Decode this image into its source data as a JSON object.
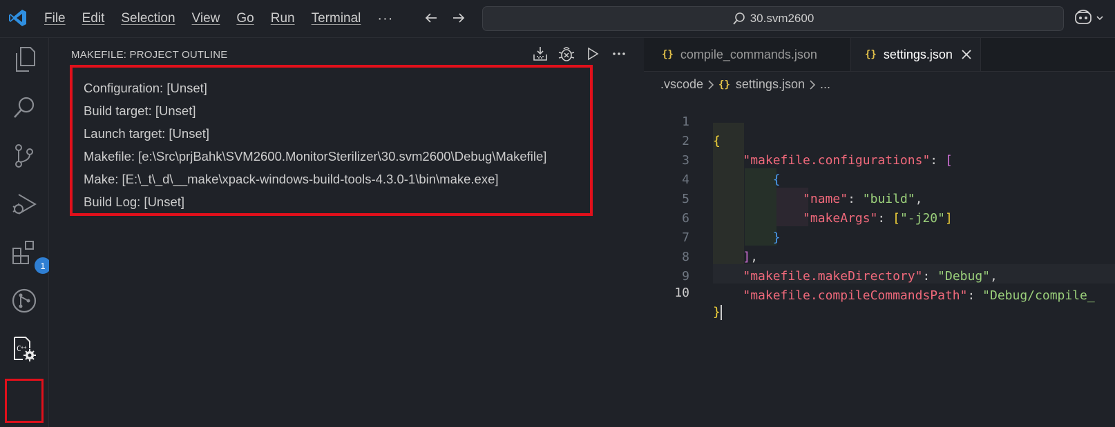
{
  "titlebar": {
    "menu": [
      "File",
      "Edit",
      "Selection",
      "View",
      "Go",
      "Run",
      "Terminal"
    ],
    "more": "···",
    "search": "30.svm2600"
  },
  "activitybar": {
    "items": [
      {
        "name": "explorer-icon"
      },
      {
        "name": "search-icon"
      },
      {
        "name": "source-control-icon"
      },
      {
        "name": "run-debug-icon"
      },
      {
        "name": "extensions-icon",
        "badge": "1"
      },
      {
        "name": "git-graph-icon"
      },
      {
        "name": "makefile-tools-icon",
        "selected": true
      }
    ]
  },
  "sidepanel": {
    "title": "MAKEFILE: PROJECT OUTLINE",
    "items": [
      "Configuration: [Unset]",
      "Build target: [Unset]",
      "Launch target: [Unset]",
      "Makefile: [e:\\Src\\prjBahk\\SVM2600.MonitorSterilizer\\30.svm2600\\Debug\\Makefile]",
      "Make: [E:\\_t\\_d\\__make\\xpack-windows-build-tools-4.3.0-1\\bin\\make.exe]",
      "Build Log: [Unset]"
    ]
  },
  "editor": {
    "tabs": [
      {
        "icon": "{}",
        "label": "compile_commands.json",
        "active": false
      },
      {
        "icon": "{}",
        "label": "settings.json",
        "active": true
      }
    ],
    "breadcrumb": {
      "folder": ".vscode",
      "icon": "{}",
      "file": "settings.json",
      "more": "..."
    },
    "line_numbers": [
      "1",
      "2",
      "3",
      "4",
      "5",
      "6",
      "7",
      "8",
      "9",
      "10"
    ],
    "code": {
      "l1": "{",
      "l2_key": "\"makefile.configurations\"",
      "l2_colon": ": ",
      "l2_open": "[",
      "l3": "{",
      "l4_key": "\"name\"",
      "l4_colon": ": ",
      "l4_val": "\"build\"",
      "l4_comma": ",",
      "l5_key": "\"makeArgs\"",
      "l5_colon": ": ",
      "l5_open": "[",
      "l5_val": "\"-j20\"",
      "l5_close": "]",
      "l6": "}",
      "l7_close": "]",
      "l7_comma": ",",
      "l8_key": "\"makefile.makeDirectory\"",
      "l8_colon": ": ",
      "l8_val": "\"Debug\"",
      "l8_comma": ",",
      "l9_key": "\"makefile.compileCommandsPath\"",
      "l9_colon": ": ",
      "l9_val": "\"Debug/compile_",
      "l10": "}"
    }
  },
  "colors": {
    "highlight_border": "#e0101b",
    "json_key": "#f0697b",
    "json_string": "#9bd07b",
    "bracket_level1": "#f3d33a",
    "bracket_level2": "#d070d6",
    "bracket_level3": "#4a9ff5",
    "badge": "#2f7fd3"
  }
}
